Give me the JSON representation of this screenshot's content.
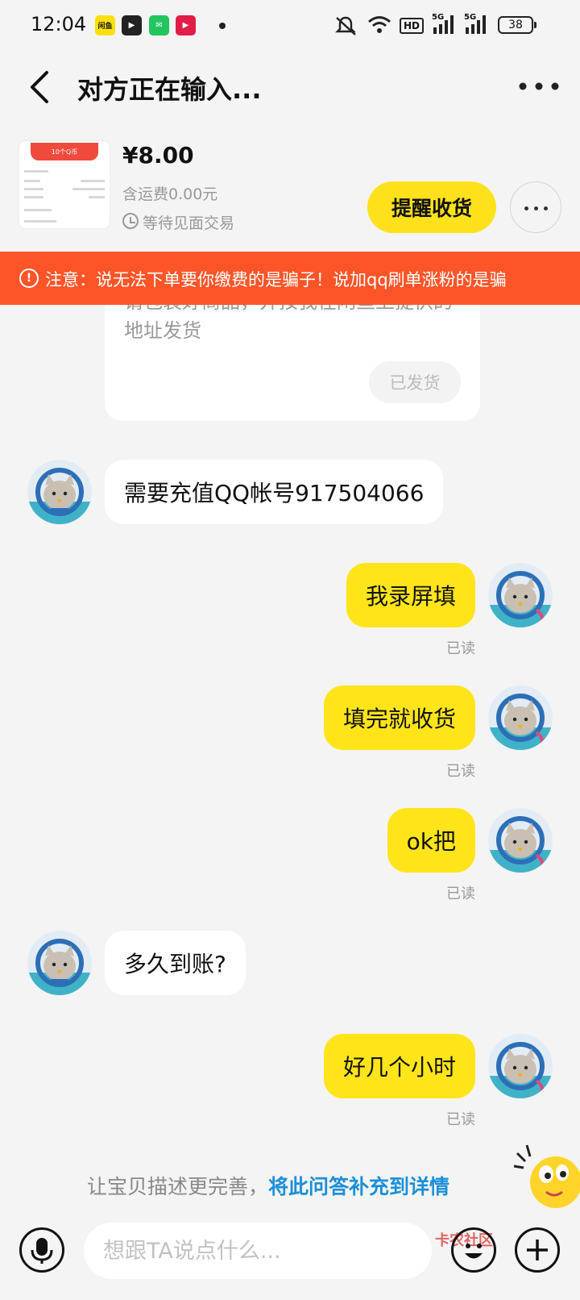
{
  "status_bar": {
    "time": "12:04",
    "apps": [
      {
        "name": "xianyu-app-icon",
        "label": "闲鱼",
        "color": "#ffe000"
      },
      {
        "name": "video-app-icon",
        "label": "▶",
        "color": "#222222"
      },
      {
        "name": "chat-app-icon",
        "label": "✉",
        "color": "#22c55e"
      },
      {
        "name": "player-app-icon",
        "label": "▶",
        "color": "#e11d48"
      }
    ],
    "battery": "38",
    "network_labels": [
      "HD",
      "5G",
      "5G"
    ]
  },
  "header": {
    "title": "对方正在输入..."
  },
  "product": {
    "thumb_caption": "10个Q币",
    "price": "¥8.00",
    "shipping": "含运费0.00元",
    "trade_status": "等待见面交易",
    "remind_label": "提醒收货"
  },
  "warning": {
    "icon": "!",
    "text": "注意：说无法下单要你缴费的是骗子！说加qq刷单涨粉的是骗"
  },
  "partial_card": {
    "text": "请包装好商品，并按我在闲鱼上提供的地址发货",
    "shipped_label": "已发货"
  },
  "messages": [
    {
      "side": "in",
      "text": "需要充值QQ帐号917504066"
    },
    {
      "side": "out",
      "text": "我录屏填",
      "read": "已读"
    },
    {
      "side": "out",
      "text": "填完就收货",
      "read": "已读"
    },
    {
      "side": "out",
      "text": "ok把",
      "read": "已读"
    },
    {
      "side": "in",
      "text": "多久到账?"
    },
    {
      "side": "out",
      "text": "好几个小时",
      "read": "已读"
    }
  ],
  "hint": {
    "text": "让宝贝描述更完善，",
    "link": "将此问答补充到详情"
  },
  "input": {
    "placeholder": "想跟TA说点什么..."
  },
  "watermark": "卡农社区",
  "colors": {
    "accent_yellow": "#ffe41a",
    "warning_orange": "#fd5528",
    "link_blue": "#1c8fd8"
  }
}
